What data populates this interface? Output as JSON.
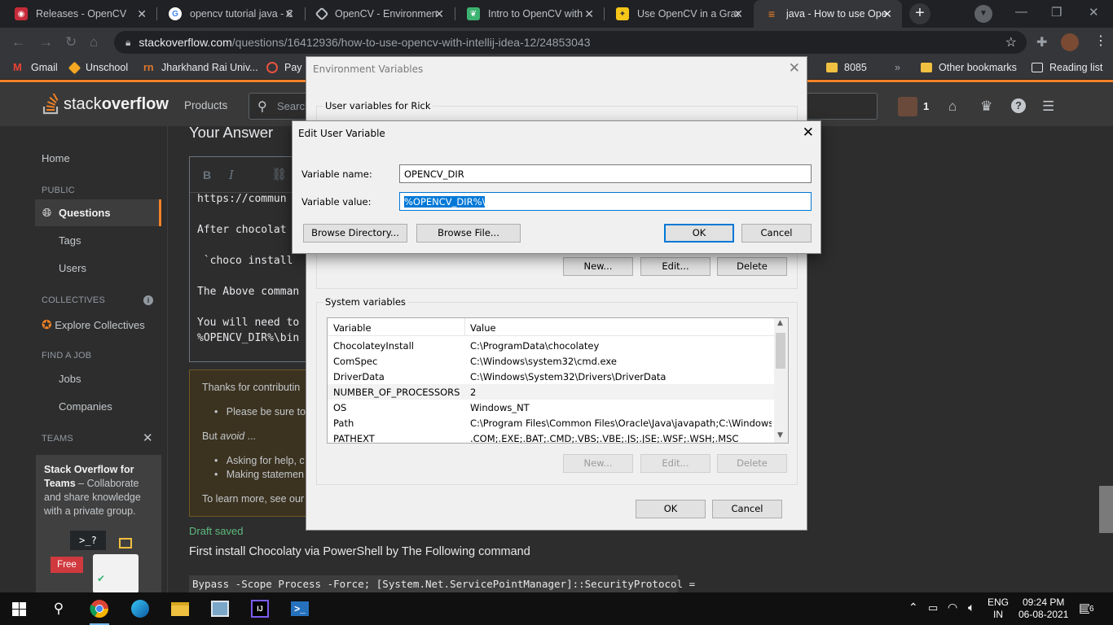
{
  "browser": {
    "tabs": [
      {
        "title": "Releases - OpenCV",
        "icon": "opencv-icon",
        "color": "#c72b3a"
      },
      {
        "title": "opencv tutorial java - G",
        "icon": "google-icon",
        "color": "#ffffff"
      },
      {
        "title": "OpenCV - Environmen",
        "icon": "compass-icon",
        "color": "#bdc1c6"
      },
      {
        "title": "Intro to OpenCV with",
        "icon": "leaf-icon",
        "color": "#3cb371"
      },
      {
        "title": "Use OpenCV in a Grad",
        "icon": "lightbulb-icon",
        "color": "#f5c518"
      },
      {
        "title": "java - How to use Ope",
        "icon": "stackoverflow-icon",
        "color": "#f48225"
      }
    ],
    "new_tab": "+",
    "url_host": "stackoverflow.com",
    "url_path": "/questions/16412936/how-to-use-opencv-with-intellij-idea-12/24853043",
    "bookmarks": [
      {
        "label": "Gmail",
        "icon": "gmail-icon",
        "color": "#ea4335"
      },
      {
        "label": "Unschool",
        "icon": "unschool-icon",
        "color": "#f5a623"
      },
      {
        "label": "Jharkhand Rai Univ...",
        "icon": "jru-icon",
        "color": "#e07a2e"
      },
      {
        "label": "Pay D",
        "icon": "pay-icon",
        "color": "#e8523f"
      },
      {
        "label": "8085",
        "icon": "folder-icon",
        "color": "#f0c040"
      },
      {
        "label": "»",
        "icon": "more-icon",
        "color": "#e8eaed"
      },
      {
        "label": "Other bookmarks",
        "icon": "folder-icon",
        "color": "#f0c040"
      },
      {
        "label": "Reading list",
        "icon": "reading-list-icon",
        "color": "#e8eaed"
      }
    ]
  },
  "so": {
    "logo_stack": "stack",
    "logo_overflow": "overflow",
    "products": "Products",
    "search_placeholder": "Search",
    "rep": "1",
    "nav": {
      "home": "Home",
      "public": "PUBLIC",
      "questions": "Questions",
      "tags": "Tags",
      "users": "Users",
      "collectives": "COLLECTIVES",
      "explore_collectives": "Explore Collectives",
      "find_job": "FIND A JOB",
      "jobs": "Jobs",
      "companies": "Companies",
      "teams": "TEAMS",
      "teams_title": "Stack Overflow for Teams",
      "teams_desc": " – Collaborate and share knowledge with a private group.",
      "free_badge": "Free",
      "prompt_glyph": ">_?"
    },
    "your_answer": "Your Answer",
    "editor_lines": [
      "https://commun",
      "After chocolat",
      " `choco install",
      "The Above comman",
      "You will need to",
      "%OPENCV_DIR%\\bin"
    ],
    "notice": {
      "thanks": "Thanks for contributin",
      "bullet1": "Please be sure to",
      "but": "But ",
      "avoid": "avoid",
      "ellipsis": " ...",
      "bullet2": "Asking for help, c",
      "bullet3": "Making statemen",
      "learn": "To learn more, see our"
    },
    "draft_saved": "Draft saved",
    "preview_text": "First install Chocolaty via PowerShell by The Following command",
    "preview_code": "Bypass -Scope Process -Force; [System.Net.ServicePointManager]::SecurityProtocol ="
  },
  "env_dialog": {
    "title": "Environment Variables",
    "user_group": "User variables for Rick",
    "btn_new": "New...",
    "btn_edit": "Edit...",
    "btn_delete": "Delete",
    "sys_group": "System variables",
    "col_variable": "Variable",
    "col_value": "Value",
    "system_vars": [
      {
        "name": "ChocolateyInstall",
        "value": "C:\\ProgramData\\chocolatey"
      },
      {
        "name": "ComSpec",
        "value": "C:\\Windows\\system32\\cmd.exe"
      },
      {
        "name": "DriverData",
        "value": "C:\\Windows\\System32\\Drivers\\DriverData"
      },
      {
        "name": "NUMBER_OF_PROCESSORS",
        "value": "2"
      },
      {
        "name": "OS",
        "value": "Windows_NT"
      },
      {
        "name": "Path",
        "value": "C:\\Program Files\\Common Files\\Oracle\\Java\\javapath;C:\\Windows..."
      },
      {
        "name": "PATHEXT",
        "value": ".COM;.EXE;.BAT;.CMD;.VBS;.VBE;.JS;.JSE;.WSF;.WSH;.MSC"
      }
    ],
    "ok": "OK",
    "cancel": "Cancel"
  },
  "edit_dialog": {
    "title": "Edit User Variable",
    "name_label": "Variable name:",
    "name_value": "OPENCV_DIR",
    "value_label": "Variable value:",
    "value_value": "%OPENCV_DIR%\\",
    "browse_dir": "Browse Directory...",
    "browse_file": "Browse File...",
    "ok": "OK",
    "cancel": "Cancel"
  },
  "taskbar": {
    "lang1": "ENG",
    "lang2": "IN",
    "time": "09:24 PM",
    "date": "06-08-2021",
    "notif": "6"
  },
  "colors": {
    "so_orange": "#f48225",
    "win_blue": "#0078d7",
    "draft_green": "#5eba7d"
  }
}
